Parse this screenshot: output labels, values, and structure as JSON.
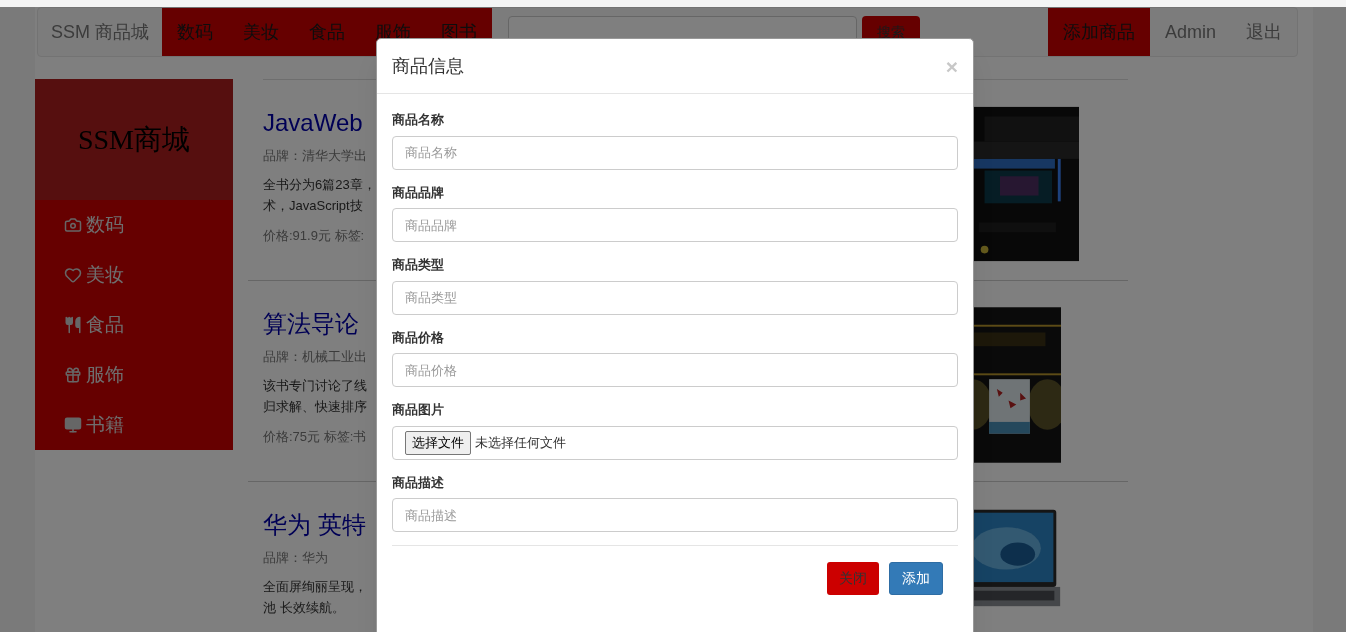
{
  "navbar": {
    "brand": "SSM 商品城",
    "categories": [
      {
        "label": "数码"
      },
      {
        "label": "美妆"
      },
      {
        "label": "食品"
      },
      {
        "label": "服饰"
      },
      {
        "label": "图书"
      }
    ],
    "search": {
      "button": "搜索"
    },
    "links": [
      {
        "label": "添加商品",
        "selected": true
      },
      {
        "label": "Admin",
        "selected": false
      },
      {
        "label": "退出",
        "selected": false
      }
    ]
  },
  "sidebar": {
    "title": "SSM商城",
    "items": [
      {
        "label": "数码"
      },
      {
        "label": "美妆"
      },
      {
        "label": "食品"
      },
      {
        "label": "服饰"
      },
      {
        "label": "书籍"
      }
    ]
  },
  "products": [
    {
      "title": "JavaWeb",
      "brand": "品牌：清华大学出",
      "description": [
        "全书分为6篇23章，",
        "术，JavaScript技"
      ],
      "meta": "价格:91.9元 标签:"
    },
    {
      "title": "算法导论",
      "brand": "品牌：机械工业出",
      "description": [
        "该书专门讨论了线",
        "归求解、快速排序"
      ],
      "meta": "价格:75元 标签:书"
    },
    {
      "title": "华为 英特",
      "brand": "品牌：华为",
      "description": [
        "全面屏绚丽呈现，",
        "池 长效续航。"
      ]
    }
  ],
  "modal": {
    "title": "商品信息",
    "close": "×",
    "fields": [
      {
        "label": "商品名称",
        "kind": "text",
        "placeholder": "商品名称"
      },
      {
        "label": "商品品牌",
        "kind": "text",
        "placeholder": "商品品牌"
      },
      {
        "label": "商品类型",
        "kind": "text",
        "placeholder": "商品类型"
      },
      {
        "label": "商品价格",
        "kind": "text",
        "placeholder": "商品价格"
      },
      {
        "label": "商品图片",
        "kind": "file",
        "button": "选择文件",
        "status": "未选择任何文件"
      },
      {
        "label": "商品描述",
        "kind": "text",
        "placeholder": "商品描述"
      }
    ],
    "buttons": [
      {
        "label": "关闭",
        "kind": "danger"
      },
      {
        "label": "添加",
        "kind": "primary"
      }
    ]
  }
}
